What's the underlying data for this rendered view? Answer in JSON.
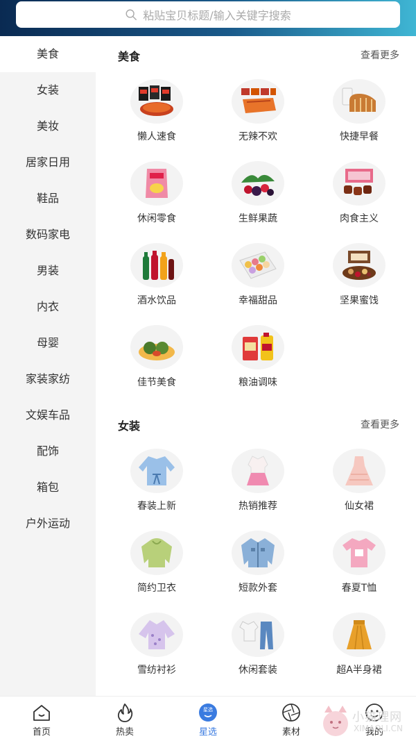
{
  "search": {
    "placeholder": "粘贴宝贝标题/输入关键字搜索"
  },
  "sidebar": {
    "items": [
      {
        "label": "美食"
      },
      {
        "label": "女装"
      },
      {
        "label": "美妆"
      },
      {
        "label": "居家日用"
      },
      {
        "label": "鞋品"
      },
      {
        "label": "数码家电"
      },
      {
        "label": "男装"
      },
      {
        "label": "内衣"
      },
      {
        "label": "母婴"
      },
      {
        "label": "家装家纺"
      },
      {
        "label": "文娱车品"
      },
      {
        "label": "配饰"
      },
      {
        "label": "箱包"
      },
      {
        "label": "户外运动"
      }
    ],
    "active_index": 0
  },
  "sections": [
    {
      "title": "美食",
      "more": "查看更多",
      "items": [
        {
          "label": "懒人速食",
          "icon": "instant-noodles-icon"
        },
        {
          "label": "无辣不欢",
          "icon": "spicy-snack-icon"
        },
        {
          "label": "快捷早餐",
          "icon": "bread-milk-icon"
        },
        {
          "label": "休闲零食",
          "icon": "chips-bag-icon"
        },
        {
          "label": "生鲜果蔬",
          "icon": "berries-icon"
        },
        {
          "label": "肉食主义",
          "icon": "beef-jerky-icon"
        },
        {
          "label": "酒水饮品",
          "icon": "drink-bottles-icon"
        },
        {
          "label": "幸福甜品",
          "icon": "macaron-box-icon"
        },
        {
          "label": "坚果蜜饯",
          "icon": "nuts-box-icon"
        },
        {
          "label": "佳节美食",
          "icon": "qingtuan-icon"
        },
        {
          "label": "粮油调味",
          "icon": "rice-oil-icon"
        }
      ]
    },
    {
      "title": "女装",
      "more": "查看更多",
      "items": [
        {
          "label": "春装上新",
          "icon": "blouse-icon"
        },
        {
          "label": "热销推荐",
          "icon": "dress-set-icon"
        },
        {
          "label": "仙女裙",
          "icon": "fairy-dress-icon"
        },
        {
          "label": "简约卫衣",
          "icon": "hoodie-icon"
        },
        {
          "label": "短款外套",
          "icon": "denim-jacket-icon"
        },
        {
          "label": "春夏T恤",
          "icon": "tshirt-icon"
        },
        {
          "label": "雪纺衬衫",
          "icon": "chiffon-shirt-icon"
        },
        {
          "label": "休闲套装",
          "icon": "casual-set-icon"
        },
        {
          "label": "超A半身裙",
          "icon": "a-line-skirt-icon"
        }
      ]
    }
  ],
  "tabbar": {
    "items": [
      {
        "label": "首页",
        "icon": "home-icon"
      },
      {
        "label": "热卖",
        "icon": "flame-icon"
      },
      {
        "label": "星选",
        "icon": "star-select-icon",
        "badge": "星选"
      },
      {
        "label": "素材",
        "icon": "aperture-icon"
      },
      {
        "label": "我的",
        "icon": "profile-icon"
      }
    ],
    "active_index": 2
  },
  "watermark": {
    "text": "小猫理网",
    "url": "XIMAOLI.CN"
  },
  "colors": {
    "accent": "#3a7be0",
    "header_start": "#0a2a52",
    "header_end": "#3fb6d4",
    "sidebar_bg": "#f4f4f4"
  }
}
